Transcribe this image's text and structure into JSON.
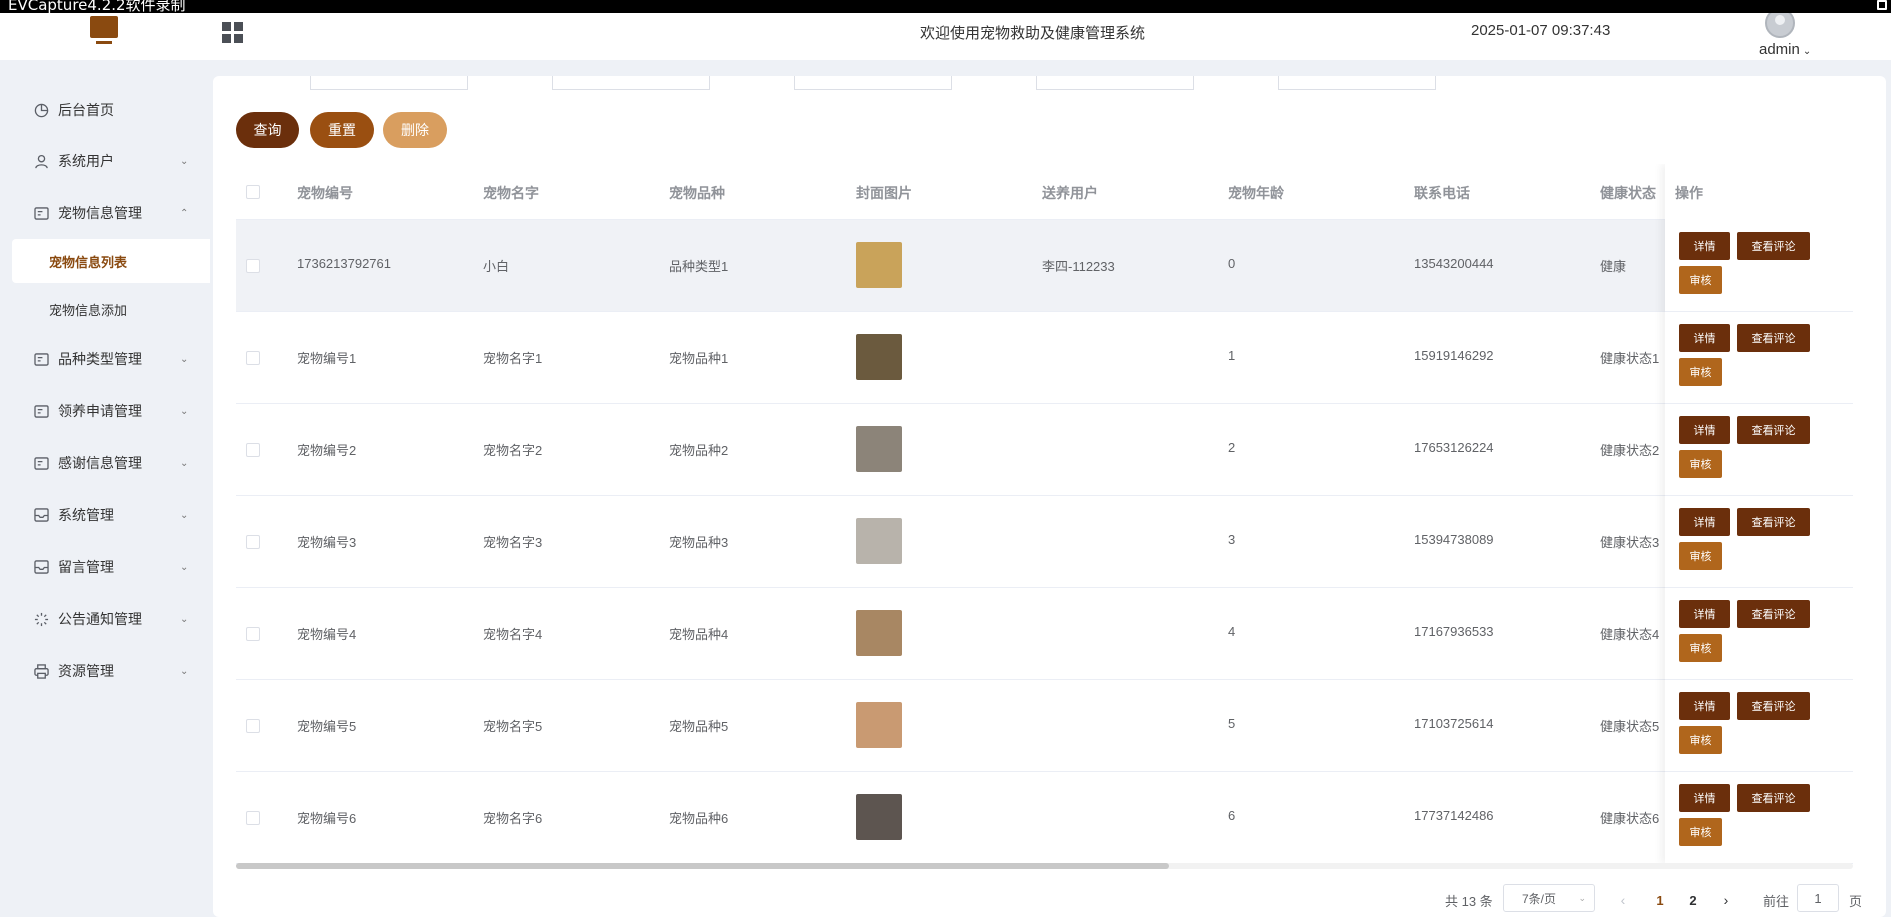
{
  "watermark": "EVCapture4.2.2软件录制",
  "header": {
    "title": "欢迎使用宠物救助及健康管理系统",
    "datetime": "2025-01-07 09:37:43",
    "username": "admin"
  },
  "sidebar": {
    "items": [
      {
        "label": "后台首页",
        "icon": "pie-chart-icon"
      },
      {
        "label": "系统用户",
        "icon": "user-icon"
      },
      {
        "label": "宠物信息管理",
        "icon": "card-icon"
      },
      {
        "label": "宠物信息列表",
        "active": true
      },
      {
        "label": "宠物信息添加"
      },
      {
        "label": "品种类型管理",
        "icon": "card-icon"
      },
      {
        "label": "领养申请管理",
        "icon": "card-icon"
      },
      {
        "label": "感谢信息管理",
        "icon": "card-icon"
      },
      {
        "label": "系统管理",
        "icon": "inbox-icon"
      },
      {
        "label": "留言管理",
        "icon": "inbox-icon"
      },
      {
        "label": "公告通知管理",
        "icon": "loading-icon"
      },
      {
        "label": "资源管理",
        "icon": "printer-icon"
      }
    ]
  },
  "toolbar": {
    "query_label": "查询",
    "reset_label": "重置",
    "delete_label": "删除"
  },
  "table": {
    "columns": [
      "宠物编号",
      "宠物名字",
      "宠物品种",
      "封面图片",
      "送养用户",
      "宠物年龄",
      "联系电话",
      "健康状态",
      "操作"
    ],
    "rows": [
      {
        "id": "1736213792761",
        "name": "小白",
        "breed": "品种类型1",
        "user": "李四-112233",
        "age": "0",
        "phone": "13543200444",
        "health": "健康",
        "thumb_color": "#c9a35a"
      },
      {
        "id": "宠物编号1",
        "name": "宠物名字1",
        "breed": "宠物品种1",
        "user": "",
        "age": "1",
        "phone": "15919146292",
        "health": "健康状态1",
        "thumb_color": "#6b5a3e"
      },
      {
        "id": "宠物编号2",
        "name": "宠物名字2",
        "breed": "宠物品种2",
        "user": "",
        "age": "2",
        "phone": "17653126224",
        "health": "健康状态2",
        "thumb_color": "#8c8479"
      },
      {
        "id": "宠物编号3",
        "name": "宠物名字3",
        "breed": "宠物品种3",
        "user": "",
        "age": "3",
        "phone": "15394738089",
        "health": "健康状态3",
        "thumb_color": "#b8b3ab"
      },
      {
        "id": "宠物编号4",
        "name": "宠物名字4",
        "breed": "宠物品种4",
        "user": "",
        "age": "4",
        "phone": "17167936533",
        "health": "健康状态4",
        "thumb_color": "#a88763"
      },
      {
        "id": "宠物编号5",
        "name": "宠物名字5",
        "breed": "宠物品种5",
        "user": "",
        "age": "5",
        "phone": "17103725614",
        "health": "健康状态5",
        "thumb_color": "#c99a72"
      },
      {
        "id": "宠物编号6",
        "name": "宠物名字6",
        "breed": "宠物品种6",
        "user": "",
        "age": "6",
        "phone": "17737142486",
        "health": "健康状态6",
        "thumb_color": "#5d5550"
      }
    ],
    "actions": {
      "detail": "详情",
      "comment": "查看评论",
      "audit": "审核"
    }
  },
  "pagination": {
    "total": "共 13 条",
    "page_size": "7条/页",
    "pages": [
      "1",
      "2"
    ],
    "current_page": "1",
    "goto_label": "前往",
    "goto_value": "1",
    "page_unit": "页"
  },
  "colors": {
    "primary_dark": "#6b2f0c",
    "primary": "#9a4f11",
    "primary_light": "#d99e5f",
    "audit": "#b0661c"
  }
}
